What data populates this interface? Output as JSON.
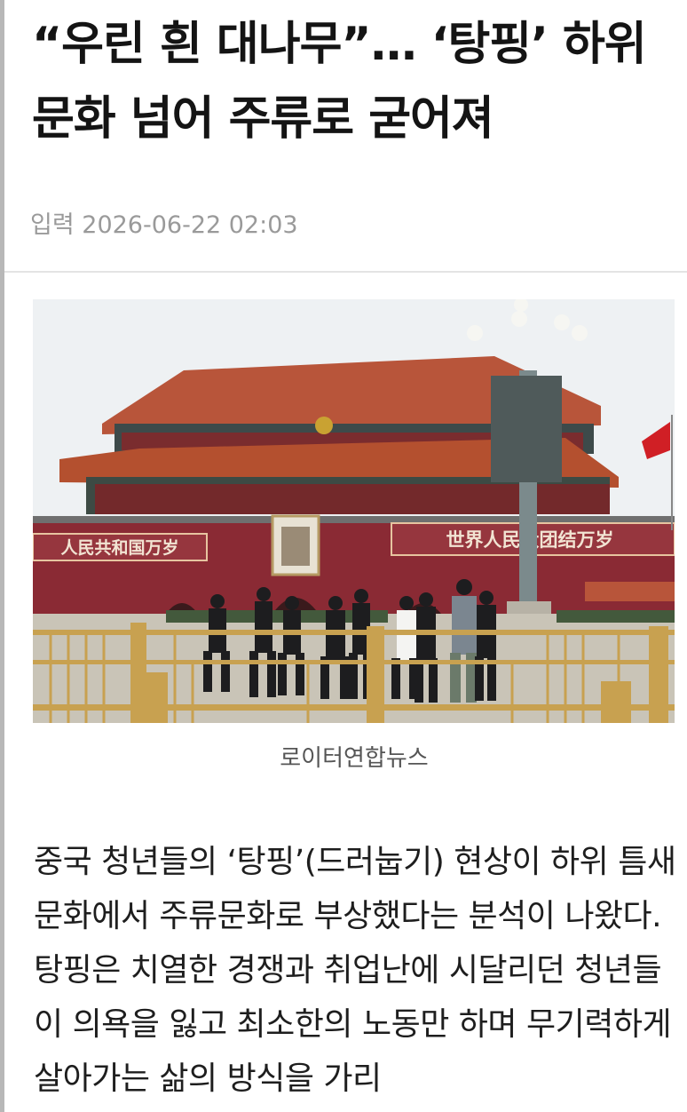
{
  "article": {
    "title": "“우린 흰 대나무”… ‘탕핑’ 하위문화 넘어 주류로 굳어져",
    "dateline": "입력 2026-06-22 02:03",
    "photo": {
      "banner_left": "人民共和国万岁",
      "banner_right": "世界人民大团结万岁",
      "caption": "로이터연합뉴스"
    },
    "body": "중국 청년들의 ‘탕핑’(드러눕기) 현상이 하위 틈새문화에서 주류문화로 부상했다는 분석이 나왔다. 탕핑은 치열한 경쟁과 취업난에 시달리던 청년들이 의욕을 잃고 최소한의 노동만 하며 무기력하게 살아가는 삶의 방식을 가리"
  },
  "colors": {
    "wall": "#8a2a34",
    "roof": "#b8553a",
    "sky": "#eef1f3",
    "railing": "#c8a150",
    "flag": "#d01f25"
  }
}
